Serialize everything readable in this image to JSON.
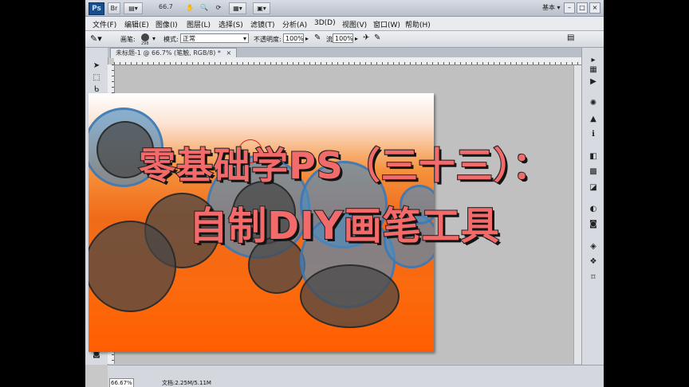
{
  "app": {
    "logo": "Ps",
    "zoom_display": "66.7",
    "workspace": "基本",
    "workspace_arrow": "▾",
    "window_min": "–",
    "window_max": "□",
    "window_close": "×"
  },
  "menu": {
    "items": [
      "文件(F)",
      "编辑(E)",
      "图像(I)",
      "图层(L)",
      "选择(S)",
      "滤镜(T)",
      "分析(A)",
      "3D(D)",
      "视图(V)",
      "窗口(W)",
      "帮助(H)"
    ]
  },
  "options": {
    "brush_label": "画笔:",
    "brush_size": "298",
    "mode_label": "模式:",
    "mode_value": "正常",
    "opacity_label": "不透明度:",
    "opacity_value": "100%",
    "flow_label": "流量:",
    "flow_value": "100%"
  },
  "document": {
    "tab_title": "未标题-1 @ 66.7% (笔触, RGB/8) *",
    "tab_close": "×"
  },
  "status": {
    "zoom": "66.67%",
    "doc_info": "文档:2.25M/5.11M"
  },
  "overlay": {
    "line1": "零基础学PS（三十三）：",
    "line2": "自制DIY画笔工具"
  },
  "colors": {
    "foreground": "#1a8ee8",
    "background": "#ffffff",
    "canvas_top": "#ffffff",
    "canvas_bottom": "#ff5e00",
    "title_fill": "#f36a6a"
  }
}
